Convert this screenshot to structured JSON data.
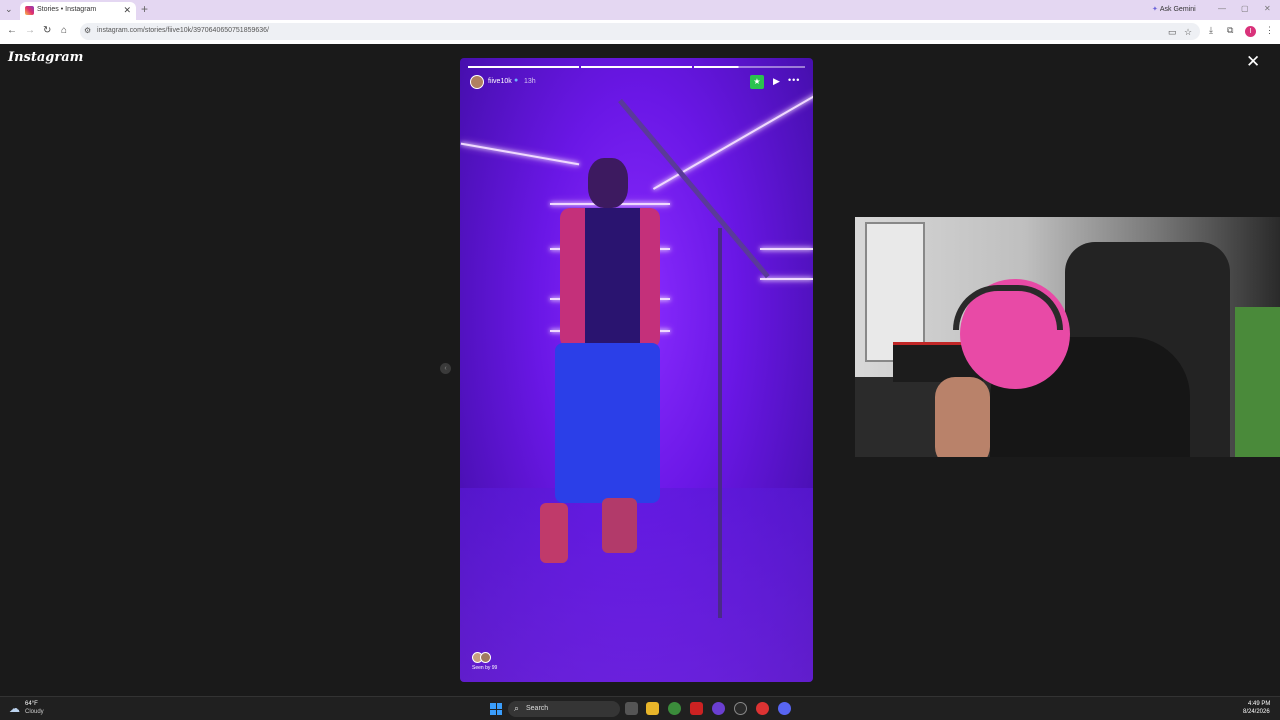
{
  "browser": {
    "tab_title": "Stories • Instagram",
    "tab_close": "✕",
    "new_tab": "+",
    "ask_gemini": "Ask Gemini",
    "url": "instagram.com/stories/fiive10k/3970640650751859636/",
    "profile_initial": "I"
  },
  "instagram": {
    "logo": "Instagram",
    "close": "✕",
    "story": {
      "username": "fiive10k",
      "time_ago": "13h",
      "progress_segments": [
        1,
        1,
        0.4
      ],
      "seen_by": "Seen by 99"
    }
  },
  "taskbar": {
    "weather_temp": "64°F",
    "weather_condition": "Cloudy",
    "search_label": "Search",
    "time": "4:49 PM",
    "date": "8/24/2026"
  },
  "colors": {
    "story_accent": "#7a22f0",
    "instagram_bg": "#1a1a1a",
    "tab_strip": "#e4d7f2",
    "green_sticker": "#2bc24e"
  }
}
